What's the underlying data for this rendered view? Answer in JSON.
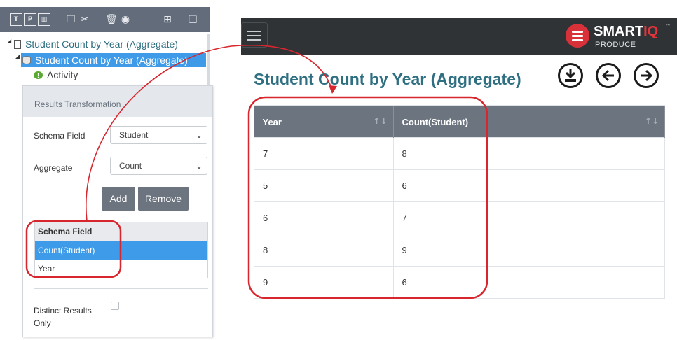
{
  "tree": {
    "items": [
      {
        "label": "Student Count by Year (Aggregate)"
      },
      {
        "label": "Student Count by Year (Aggregate)"
      },
      {
        "label": "Activity"
      }
    ]
  },
  "transform_panel": {
    "title": "Results Transformation",
    "schema_field_label": "Schema Field",
    "schema_field_value": "Student",
    "aggregate_label": "Aggregate",
    "aggregate_value": "Count",
    "add_label": "Add",
    "remove_label": "Remove",
    "table_header": "Schema Field",
    "rows": [
      "Count(Student)",
      "Year"
    ],
    "distinct_label": "Distinct Results Only"
  },
  "app": {
    "logo_main": "SMART",
    "logo_accent": "IQ",
    "logo_tm": "™",
    "logo_sub": "PRODUCE",
    "page_title": "Student Count by Year (Aggregate)"
  },
  "results_table": {
    "columns": [
      "Year",
      "Count(Student)"
    ],
    "rows": [
      [
        "7",
        "8"
      ],
      [
        "5",
        "6"
      ],
      [
        "6",
        "7"
      ],
      [
        "8",
        "9"
      ],
      [
        "9",
        "6"
      ]
    ]
  },
  "colors": {
    "accent_red": "#d9313a",
    "header_gray": "#6c7480",
    "selection_blue": "#3d9be9",
    "title_teal": "#2f6f82"
  }
}
